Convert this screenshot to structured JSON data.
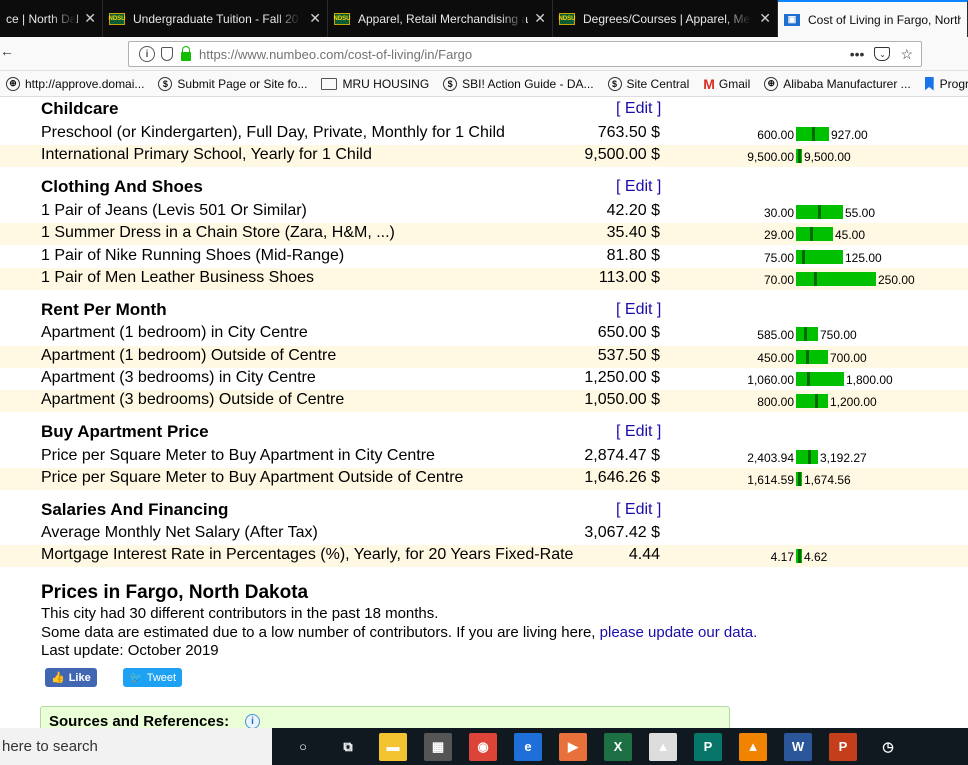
{
  "browser": {
    "tabs": [
      {
        "title": "ce | North Dak",
        "favicon": "generic",
        "active": false
      },
      {
        "title": "Undergraduate Tuition - Fall 20",
        "favicon": "ndsu",
        "active": false
      },
      {
        "title": "Apparel, Retail Merchandising a",
        "favicon": "ndsu",
        "active": false
      },
      {
        "title": "Degrees/Courses | Apparel, Me",
        "favicon": "ndsu",
        "active": false
      },
      {
        "title": "Cost of Living in Fargo, North",
        "favicon": "numbeo",
        "active": true
      }
    ],
    "favicon_text": "NDSU",
    "url": "https://www.numbeo.com/cost-of-living/in/Fargo",
    "url_actions": {
      "more": "•••"
    },
    "bookmarks": [
      {
        "label": "http://approve.domai...",
        "icon": "globe-icon"
      },
      {
        "label": "Submit Page or Site fo...",
        "icon": "dollar-icon"
      },
      {
        "label": "MRU HOUSING",
        "icon": "folder-icon"
      },
      {
        "label": "SBI! Action Guide - DA...",
        "icon": "dollar-icon"
      },
      {
        "label": "Site Central",
        "icon": "dollar-icon"
      },
      {
        "label": "Gmail",
        "icon": "gmail-icon"
      },
      {
        "label": "Alibaba Manufacturer ...",
        "icon": "globe-icon"
      },
      {
        "label": "Progra",
        "icon": "bookmark-flag-icon"
      }
    ]
  },
  "sections": [
    {
      "title": "Childcare",
      "edit": "[ Edit ]",
      "rows": [
        {
          "label": "Preschool (or Kindergarten), Full Day, Private, Monthly for 1 Child",
          "price": "763.50 $",
          "low": "600.00",
          "high": "927.00",
          "value_pos": 0.5,
          "bar_width": 33
        },
        {
          "label": "International Primary School, Yearly for 1 Child",
          "price": "9,500.00 $",
          "low": "9,500.00",
          "high": "9,500.00",
          "value_pos": 0.5,
          "bar_width": 6
        }
      ]
    },
    {
      "title": "Clothing And Shoes",
      "edit": "[ Edit ]",
      "rows": [
        {
          "label": "1 Pair of Jeans (Levis 501 Or Similar)",
          "price": "42.20 $",
          "low": "30.00",
          "high": "55.00",
          "value_pos": 0.49,
          "bar_width": 47
        },
        {
          "label": "1 Summer Dress in a Chain Store (Zara, H&M, ...)",
          "price": "35.40 $",
          "low": "29.00",
          "high": "45.00",
          "value_pos": 0.4,
          "bar_width": 37
        },
        {
          "label": "1 Pair of Nike Running Shoes (Mid-Range)",
          "price": "81.80 $",
          "low": "75.00",
          "high": "125.00",
          "value_pos": 0.14,
          "bar_width": 47
        },
        {
          "label": "1 Pair of Men Leather Business Shoes",
          "price": "113.00 $",
          "low": "70.00",
          "high": "250.00",
          "value_pos": 0.24,
          "bar_width": 80
        }
      ]
    },
    {
      "title": "Rent Per Month",
      "edit": "[ Edit ]",
      "rows": [
        {
          "label": "Apartment (1 bedroom) in City Centre",
          "price": "650.00 $",
          "low": "585.00",
          "high": "750.00",
          "value_pos": 0.39,
          "bar_width": 22
        },
        {
          "label": "Apartment (1 bedroom) Outside of Centre",
          "price": "537.50 $",
          "low": "450.00",
          "high": "700.00",
          "value_pos": 0.35,
          "bar_width": 32
        },
        {
          "label": "Apartment (3 bedrooms) in City Centre",
          "price": "1,250.00 $",
          "low": "1,060.00",
          "high": "1,800.00",
          "value_pos": 0.26,
          "bar_width": 48
        },
        {
          "label": "Apartment (3 bedrooms) Outside of Centre",
          "price": "1,050.00 $",
          "low": "800.00",
          "high": "1,200.00",
          "value_pos": 0.63,
          "bar_width": 32
        }
      ]
    },
    {
      "title": "Buy Apartment Price",
      "edit": "[ Edit ]",
      "rows": [
        {
          "label": "Price per Square Meter to Buy Apartment in City Centre",
          "price": "2,874.47 $",
          "low": "2,403.94",
          "high": "3,192.27",
          "value_pos": 0.6,
          "bar_width": 22
        },
        {
          "label": "Price per Square Meter to Buy Apartment Outside of Centre",
          "price": "1,646.26 $",
          "low": "1,614.59",
          "high": "1,674.56",
          "value_pos": 0.5,
          "bar_width": 6
        }
      ]
    },
    {
      "title": "Salaries And Financing",
      "edit": "[ Edit ]",
      "rows": [
        {
          "label": "Average Monthly Net Salary (After Tax)",
          "price": "3,067.42 $",
          "low": "",
          "high": "",
          "value_pos": 0,
          "bar_width": 0
        },
        {
          "label": "Mortgage Interest Rate in Percentages (%), Yearly, for 20 Years Fixed-Rate",
          "price": "4.44",
          "low": "4.17",
          "high": "4.62",
          "value_pos": 0.5,
          "bar_width": 6
        }
      ]
    }
  ],
  "prices": {
    "title": "Prices in Fargo, North Dakota",
    "line1": "This city had 30 different contributors in the past 18 months.",
    "line2": "Some data are estimated due to a low number of contributors. If you are living here,",
    "link": "please update our data.",
    "line3": "Last update: October 2019"
  },
  "social": {
    "like": "Like",
    "tweet": "Tweet"
  },
  "sources": {
    "title": "Sources and References:"
  },
  "taskbar": {
    "search_placeholder": "here to search",
    "apps": [
      {
        "name": "cortana-icon",
        "glyph": "○",
        "color": "transparent"
      },
      {
        "name": "task-view-icon",
        "glyph": "⧉",
        "color": "transparent"
      },
      {
        "name": "file-explorer-icon",
        "glyph": "▬",
        "color": "#f4c430"
      },
      {
        "name": "calculator-icon",
        "glyph": "▦",
        "color": "#555555"
      },
      {
        "name": "chrome-icon",
        "glyph": "◉",
        "color": "#db4437"
      },
      {
        "name": "edge-icon",
        "glyph": "e",
        "color": "#1e6fd9"
      },
      {
        "name": "media-player-icon",
        "glyph": "▶",
        "color": "#e8713b"
      },
      {
        "name": "excel-icon",
        "glyph": "X",
        "color": "#1d7044"
      },
      {
        "name": "photos-icon",
        "glyph": "▲",
        "color": "#dddddd"
      },
      {
        "name": "publisher-icon",
        "glyph": "P",
        "color": "#077568"
      },
      {
        "name": "vlc-icon",
        "glyph": "▲",
        "color": "#f08300"
      },
      {
        "name": "word-icon",
        "glyph": "W",
        "color": "#2b579a"
      },
      {
        "name": "powerpoint-icon",
        "glyph": "P",
        "color": "#c43e1c"
      },
      {
        "name": "alarm-clock-icon",
        "glyph": "◷",
        "color": "transparent"
      }
    ]
  }
}
